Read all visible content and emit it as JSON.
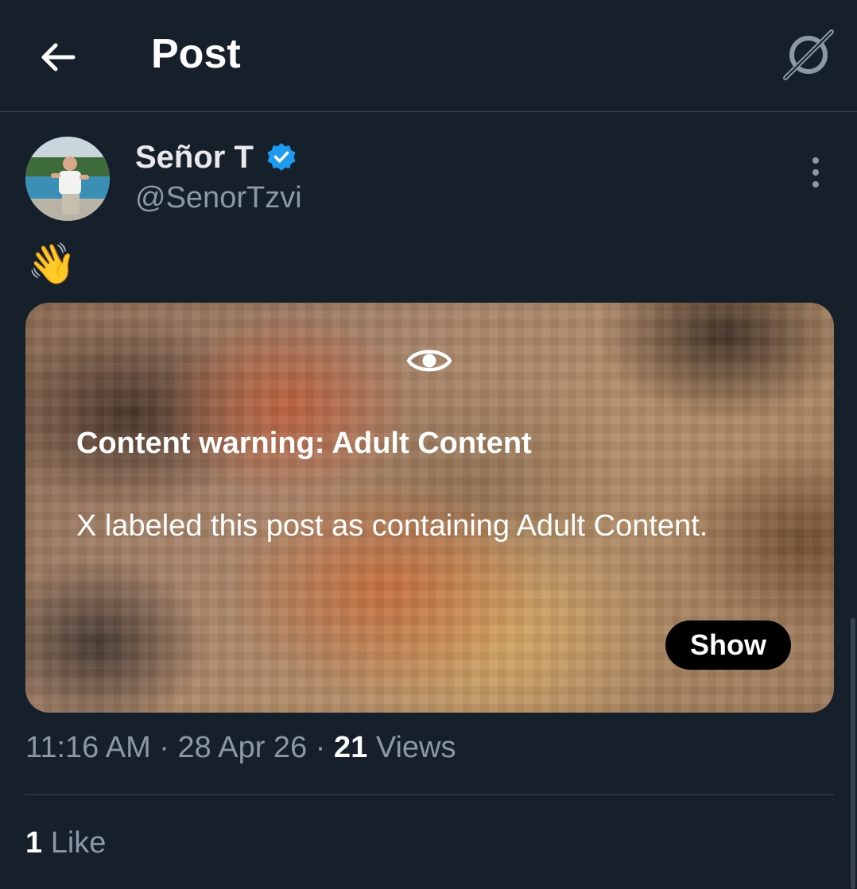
{
  "header": {
    "title": "Post",
    "back_icon": "arrow-left-icon",
    "grok_icon": "grok-icon"
  },
  "author": {
    "name": "Señor T",
    "handle": "@SenorTzvi",
    "verified": true,
    "verified_color": "#1d9bf0"
  },
  "post": {
    "text": "👋"
  },
  "media": {
    "eye_icon": "eye-icon",
    "warning_title": "Content warning: Adult Content",
    "warning_body": "X labeled this post as containing Adult Content.",
    "show_label": "Show"
  },
  "meta": {
    "time": "11:16 AM",
    "separator": " · ",
    "date": "28 Apr 26",
    "views_count": "21",
    "views_label": " Views"
  },
  "engagement": {
    "likes_count": "1",
    "likes_label": " Like"
  },
  "colors": {
    "background": "#15202b",
    "divider": "#38444d",
    "secondary_text": "#8b98a5",
    "primary_text": "#e7e9ea"
  }
}
